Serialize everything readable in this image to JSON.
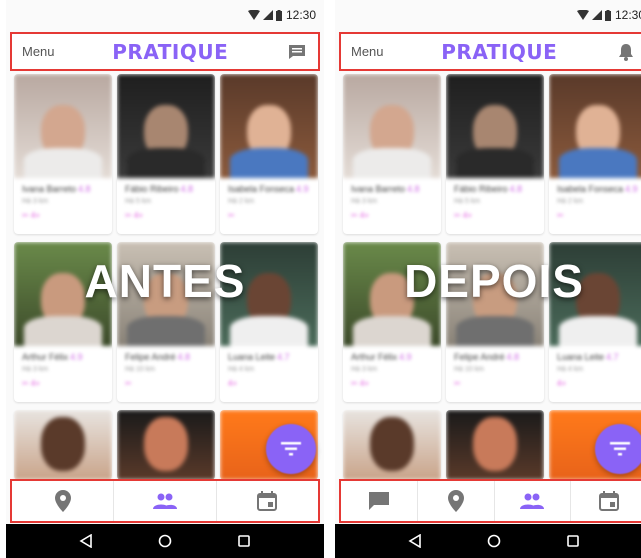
{
  "status_time": "12:30",
  "app": {
    "menu_label": "Menu",
    "brand": "PRATIQUE"
  },
  "colors": {
    "accent": "#8a63f6",
    "highlight_border": "#e53935",
    "pink": "#e25be0"
  },
  "left": {
    "overlay_label": "ANTES",
    "top_right_icon": "message-icon",
    "bottom_tabs": [
      "location-pin-icon",
      "people-icon",
      "calendar-icon"
    ],
    "active_tab_index": 1
  },
  "right": {
    "overlay_label": "DEPOIS",
    "top_right_icon": "bell-icon",
    "bottom_tabs": [
      "message-icon",
      "location-pin-icon",
      "people-icon",
      "calendar-icon"
    ],
    "active_tab_index": 2
  },
  "profiles": [
    {
      "name": "Ivana Barreto",
      "rating": "4.8",
      "sub": "Há 3 km",
      "meta": "✂ 4+"
    },
    {
      "name": "Fábio Ribeiro",
      "rating": "4.8",
      "sub": "Há 5 km",
      "meta": "✂ 4+"
    },
    {
      "name": "Isabela Fonseca",
      "rating": "4.9",
      "sub": "Há 2 km",
      "meta": "✂"
    },
    {
      "name": "Arthur Félix",
      "rating": "4.9",
      "sub": "Há 3 km",
      "meta": "✂ 4+"
    },
    {
      "name": "Felipe André",
      "rating": "4.8",
      "sub": "Há 10 km",
      "meta": "✂"
    },
    {
      "name": "Luana Leite",
      "rating": "4.7",
      "sub": "Há 4 km",
      "meta": "4+"
    }
  ],
  "nav_buttons": [
    "back-icon",
    "home-icon",
    "recents-icon"
  ]
}
